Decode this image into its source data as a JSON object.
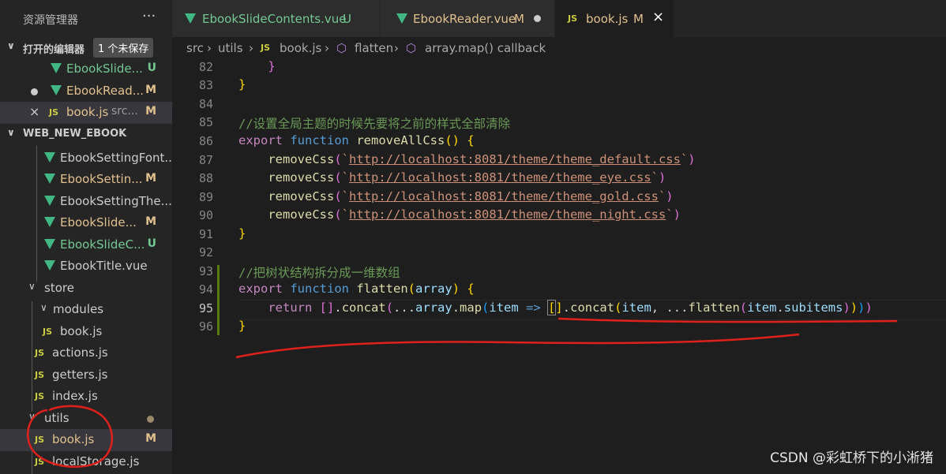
{
  "sidebar": {
    "title": "资源管理器",
    "more_icon": "ellipsis-icon",
    "open_editors": {
      "label": "打开的编辑器",
      "badge": "1 个未保存",
      "items": [
        {
          "name": "EbookSlide...",
          "status": "U",
          "type": "vue"
        },
        {
          "name": "EbookRead...",
          "status": "M",
          "type": "vue"
        },
        {
          "name": "book.js",
          "path": "src...",
          "status": "M",
          "type": "js"
        }
      ]
    },
    "project": {
      "label": "WEB_NEW_EBOOK",
      "files": [
        {
          "name": "EbookSettingFont...",
          "status": ""
        },
        {
          "name": "EbookSettin...",
          "status": "M"
        },
        {
          "name": "EbookSettingThe...",
          "status": ""
        },
        {
          "name": "EbookSlide...",
          "status": "M"
        },
        {
          "name": "EbookSlideC...",
          "status": "U"
        },
        {
          "name": "EbookTitle.vue",
          "status": ""
        },
        {
          "name": "store"
        },
        {
          "name": "modules"
        },
        {
          "name": "book.js"
        },
        {
          "name": "actions.js"
        },
        {
          "name": "getters.js"
        },
        {
          "name": "index.js"
        },
        {
          "name": "utils"
        },
        {
          "name": "book.js",
          "status": "M"
        },
        {
          "name": "localStorage.js"
        }
      ]
    }
  },
  "tabs": [
    {
      "label": "EbookSlideContents.vue",
      "status": "U"
    },
    {
      "label": "EbookReader.vue",
      "status": "M"
    },
    {
      "label": "book.js",
      "status": "M",
      "close": "×"
    }
  ],
  "breadcrumb": [
    "src",
    "utils",
    "book.js",
    "flatten",
    "array.map() callback"
  ],
  "code": {
    "line_numbers": [
      "82",
      "83",
      "84",
      "85",
      "86",
      "87",
      "88",
      "89",
      "90",
      "91",
      "92",
      "93",
      "94",
      "95",
      "96"
    ],
    "l82": "}",
    "l83": "}",
    "l85": "//设置全局主题的时候先要将之前的样式全部清除",
    "l86_kw": "export",
    "l86_kw2": "function",
    "l86_fn": "removeAllCss",
    "removeCss": "removeCss",
    "css_urls": [
      "http://localhost:8081/theme/theme_default.css",
      "http://localhost:8081/theme/theme_eye.css",
      "http://localhost:8081/theme/theme_gold.css",
      "http://localhost:8081/theme/theme_night.css"
    ],
    "l91": "}",
    "l93": "//把树状结构拆分成一维数组",
    "l94_fn": "flatten",
    "l94_param": "array",
    "l95_return": "return",
    "l95_concat": "concat",
    "l95_map": "map",
    "l95_item": "item",
    "l95_arrow": "=>",
    "l95_subitems": "subitems",
    "l96": "}"
  },
  "watermark": "CSDN @彩虹桥下的小淅猪",
  "colors": {
    "vue": "#41b883",
    "js": "#cbcb41",
    "modified": "#e2c08d",
    "untracked": "#73c991",
    "annotation": "#e0201b"
  }
}
